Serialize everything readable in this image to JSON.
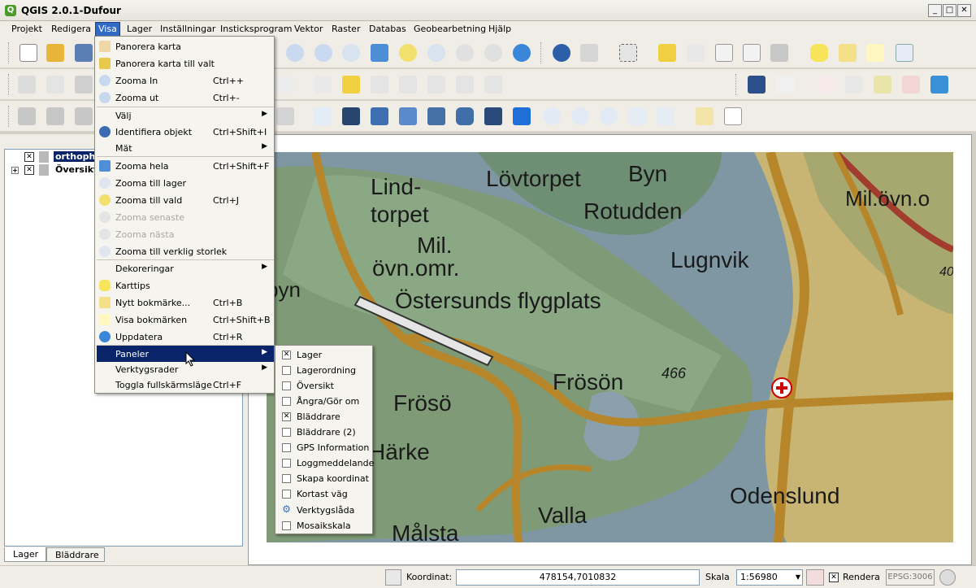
{
  "window": {
    "title": "QGIS 2.0.1-Dufour"
  },
  "menubar": [
    "Projekt",
    "Redigera",
    "Visa",
    "Lager",
    "Inställningar",
    "Insticksprogram",
    "Vektor",
    "Raster",
    "Databas",
    "Geobearbetning",
    "Hjälp"
  ],
  "visa_menu": [
    {
      "label": "Panorera karta",
      "shortcut": "",
      "icon": "pan-hand-icon"
    },
    {
      "label": "Panorera karta till valt",
      "shortcut": "",
      "icon": "pan-to-selected-icon"
    },
    {
      "label": "Zooma In",
      "shortcut": "Ctrl++",
      "icon": "zoom-in-icon"
    },
    {
      "label": "Zooma ut",
      "shortcut": "Ctrl+-",
      "icon": "zoom-out-icon"
    },
    {
      "label": "Välj",
      "shortcut": "",
      "icon": "",
      "submenu": true
    },
    {
      "label": "Identifiera objekt",
      "shortcut": "Ctrl+Shift+I",
      "icon": "identify-icon"
    },
    {
      "label": "Mät",
      "shortcut": "",
      "icon": "",
      "submenu": true
    },
    {
      "label": "Zooma hela",
      "shortcut": "Ctrl+Shift+F",
      "icon": "zoom-full-icon"
    },
    {
      "label": "Zooma till lager",
      "shortcut": "",
      "icon": "zoom-layer-icon"
    },
    {
      "label": "Zooma till vald",
      "shortcut": "Ctrl+J",
      "icon": "zoom-selected-icon"
    },
    {
      "label": "Zooma senaste",
      "shortcut": "",
      "icon": "zoom-last-icon",
      "disabled": true
    },
    {
      "label": "Zooma nästa",
      "shortcut": "",
      "icon": "zoom-next-icon",
      "disabled": true
    },
    {
      "label": "Zooma till verklig storlek",
      "shortcut": "",
      "icon": "zoom-actual-icon"
    },
    {
      "label": "Dekoreringar",
      "shortcut": "",
      "icon": "",
      "submenu": true
    },
    {
      "label": "Karttips",
      "shortcut": "",
      "icon": "map-tips-icon"
    },
    {
      "label": "Nytt bokmärke...",
      "shortcut": "Ctrl+B",
      "icon": "new-bookmark-icon"
    },
    {
      "label": "Visa bokmärken",
      "shortcut": "Ctrl+Shift+B",
      "icon": "show-bookmarks-icon"
    },
    {
      "label": "Uppdatera",
      "shortcut": "Ctrl+R",
      "icon": "refresh-icon"
    },
    {
      "label": "Paneler",
      "shortcut": "",
      "icon": "",
      "submenu": true,
      "highlight": true
    },
    {
      "label": "Verktygsrader",
      "shortcut": "",
      "icon": "",
      "submenu": true
    },
    {
      "label": "Toggla fullskärmsläge",
      "shortcut": "Ctrl+F",
      "icon": ""
    }
  ],
  "paneler_submenu": [
    {
      "label": "Lager",
      "checked": true
    },
    {
      "label": "Lagerordning",
      "checked": false
    },
    {
      "label": "Översikt",
      "checked": false
    },
    {
      "label": "Ångra/Gör om",
      "checked": false
    },
    {
      "label": "Bläddrare",
      "checked": true
    },
    {
      "label": "Bläddrare (2)",
      "checked": false
    },
    {
      "label": "GPS Information",
      "checked": false
    },
    {
      "label": "Loggmeddelande",
      "checked": false
    },
    {
      "label": "Skapa koordinat",
      "checked": false
    },
    {
      "label": "Kortast väg",
      "checked": false
    },
    {
      "label": "Verktygslåda",
      "checked": false,
      "gear": true
    },
    {
      "label": "Mosaikskala",
      "checked": false
    }
  ],
  "layers": [
    "orthoph",
    "Översikt"
  ],
  "left_tabs": [
    "Lager",
    "Bläddrare"
  ],
  "map_labels": [
    "Lind-",
    "torpet",
    "Lövtorpet",
    "Byn",
    "Rotudden",
    "Mil.övn.o",
    "Mil.",
    "övn.omr.",
    "Östersunds flygplats",
    "Lugnvik",
    "byn",
    "Frösön",
    "466",
    "Frösö",
    "Härke",
    "Valla",
    "Odenslund",
    "Målsta",
    "40"
  ],
  "status": {
    "coord_label": "Koordinat:",
    "coord_value": "478154,7010832",
    "scale_label": "Skala",
    "scale_value": "1:56980",
    "render_label": "Rendera",
    "epsg": "EPSG:3006"
  }
}
